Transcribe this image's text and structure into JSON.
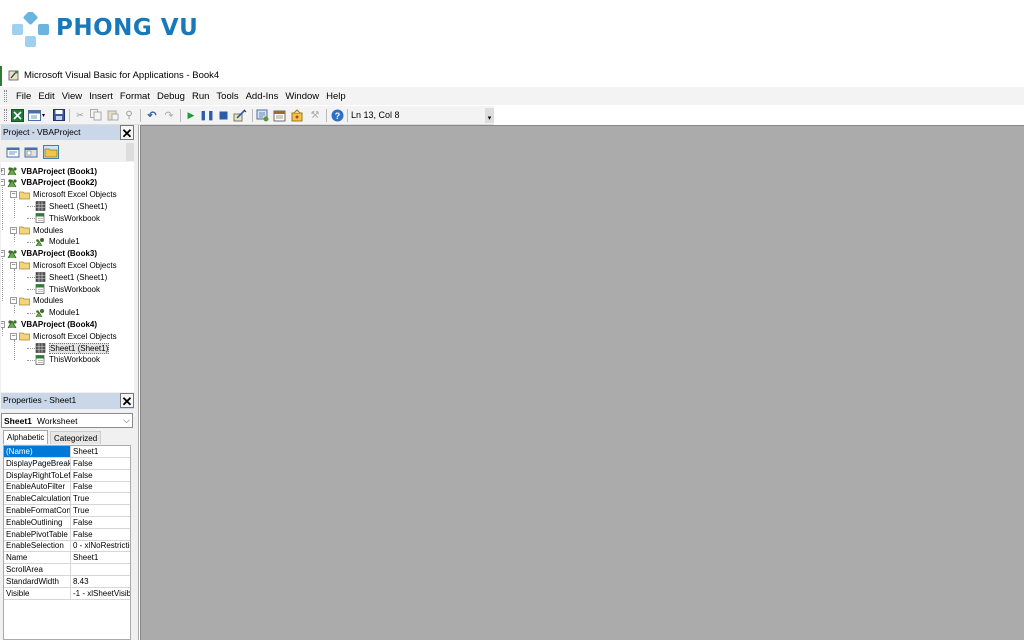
{
  "brand": {
    "logo_text": "PHONG VU",
    "colors": {
      "primary": "#1779ba",
      "light": "#6bb4e0",
      "pale": "#9fd0ef"
    }
  },
  "window": {
    "title": "Microsoft Visual Basic for Applications - Book4",
    "title_icon": "vba-app-icon"
  },
  "menubar": {
    "items": [
      "File",
      "Edit",
      "View",
      "Insert",
      "Format",
      "Debug",
      "Run",
      "Tools",
      "Add-Ins",
      "Window",
      "Help"
    ]
  },
  "toolbar": {
    "buttons": [
      "view-excel-icon",
      "insert-module-icon",
      "save-icon",
      "cut-icon",
      "copy-icon",
      "paste-icon",
      "find-icon",
      "undo-icon",
      "redo-icon",
      "run-icon",
      "break-icon",
      "reset-icon",
      "design-mode-icon",
      "project-explorer-icon",
      "properties-window-icon",
      "object-browser-icon",
      "toolbox-icon",
      "help-icon"
    ],
    "cursor_position": "Ln 13, Col 8"
  },
  "project_pane": {
    "title": "Project - VBAProject",
    "close_label": "✕",
    "tree": [
      {
        "label": "VBAProject (Book1)",
        "level": 0,
        "expander": "+",
        "icon": "vba-project-icon",
        "bold": true
      },
      {
        "label": "VBAProject (Book2)",
        "level": 0,
        "expander": "−",
        "icon": "vba-project-icon",
        "bold": true
      },
      {
        "label": "Microsoft Excel Objects",
        "level": 1,
        "expander": "−",
        "icon": "folder-icon"
      },
      {
        "label": "Sheet1 (Sheet1)",
        "level": 2,
        "icon": "worksheet-icon"
      },
      {
        "label": "ThisWorkbook",
        "level": 2,
        "icon": "workbook-icon"
      },
      {
        "label": "Modules",
        "level": 1,
        "expander": "−",
        "icon": "folder-icon"
      },
      {
        "label": "Module1",
        "level": 2,
        "icon": "module-icon"
      },
      {
        "label": "VBAProject (Book3)",
        "level": 0,
        "expander": "−",
        "icon": "vba-project-icon",
        "bold": true
      },
      {
        "label": "Microsoft Excel Objects",
        "level": 1,
        "expander": "−",
        "icon": "folder-icon"
      },
      {
        "label": "Sheet1 (Sheet1)",
        "level": 2,
        "icon": "worksheet-icon"
      },
      {
        "label": "ThisWorkbook",
        "level": 2,
        "icon": "workbook-icon"
      },
      {
        "label": "Modules",
        "level": 1,
        "expander": "−",
        "icon": "folder-icon"
      },
      {
        "label": "Module1",
        "level": 2,
        "icon": "module-icon"
      },
      {
        "label": "VBAProject (Book4)",
        "level": 0,
        "expander": "−",
        "icon": "vba-project-icon",
        "bold": true
      },
      {
        "label": "Microsoft Excel Objects",
        "level": 1,
        "expander": "−",
        "icon": "folder-icon"
      },
      {
        "label": "Sheet1 (Sheet1)",
        "level": 2,
        "icon": "worksheet-icon",
        "selected": true
      },
      {
        "label": "ThisWorkbook",
        "level": 2,
        "icon": "workbook-icon"
      }
    ]
  },
  "properties_pane": {
    "title": "Properties - Sheet1",
    "close_label": "✕",
    "object_name": "Sheet1",
    "object_type": "Worksheet",
    "tabs": [
      "Alphabetic",
      "Categorized"
    ],
    "rows": [
      {
        "name": "(Name)",
        "value": "Sheet1",
        "selected": true
      },
      {
        "name": "DisplayPageBreak",
        "value": "False"
      },
      {
        "name": "DisplayRightToLef",
        "value": "False"
      },
      {
        "name": "EnableAutoFilter",
        "value": "False"
      },
      {
        "name": "EnableCalculation",
        "value": "True"
      },
      {
        "name": "EnableFormatCon",
        "value": "True"
      },
      {
        "name": "EnableOutlining",
        "value": "False"
      },
      {
        "name": "EnablePivotTable",
        "value": "False"
      },
      {
        "name": "EnableSelection",
        "value": "0 - xlNoRestrictio"
      },
      {
        "name": "Name",
        "value": "Sheet1"
      },
      {
        "name": "ScrollArea",
        "value": ""
      },
      {
        "name": "StandardWidth",
        "value": "8.43"
      },
      {
        "name": "Visible",
        "value": "-1 - xlSheetVisib"
      }
    ]
  }
}
